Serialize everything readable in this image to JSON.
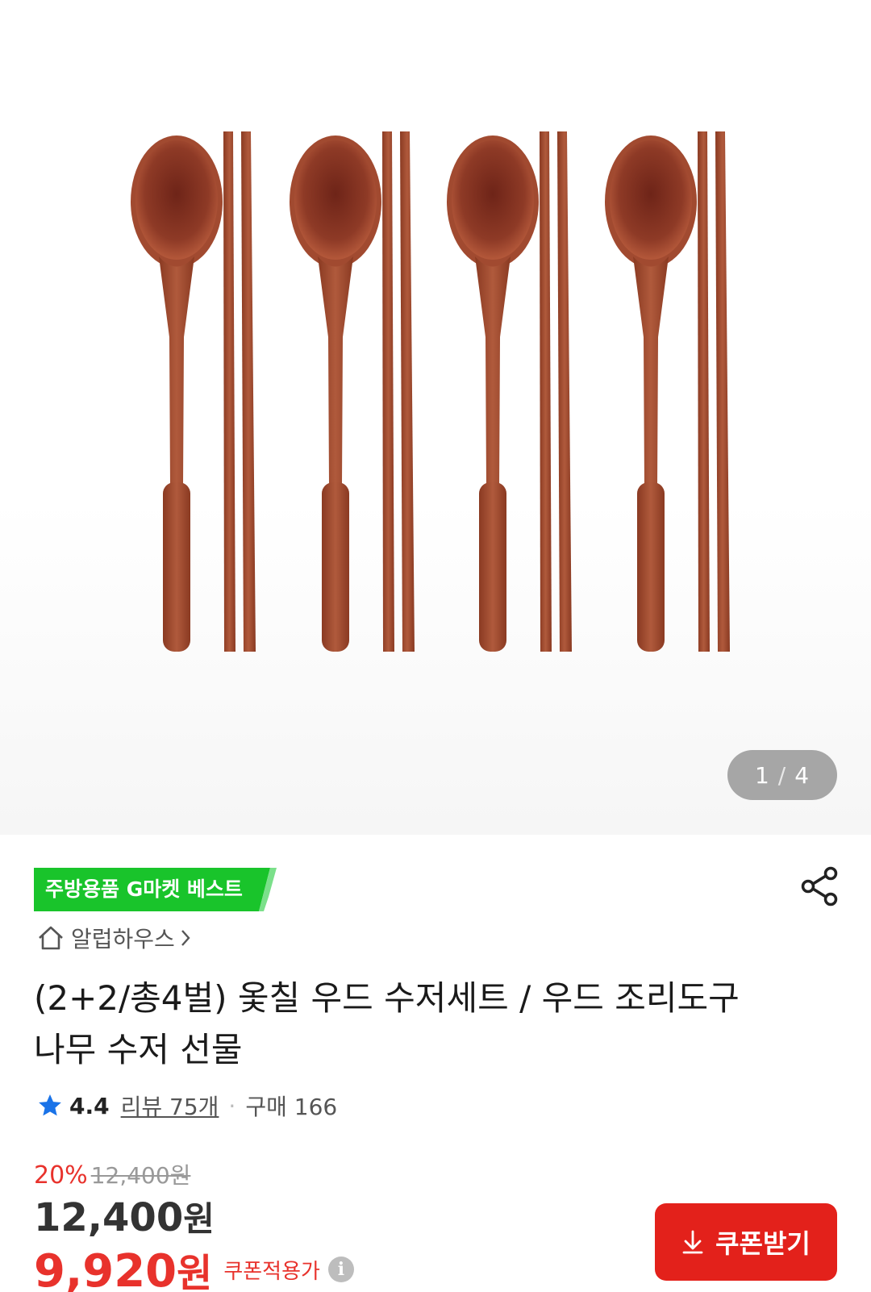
{
  "gallery": {
    "current": "1",
    "separator": "/",
    "total": "4"
  },
  "badge": {
    "label": "주방용품 G마켓 베스트",
    "color": "#19c42b"
  },
  "seller": {
    "name": "알럽하우스"
  },
  "product": {
    "title": "(2+2/총4벌) 옻칠 우드 수저세트 / 우드 조리도구 나무 수저 선물"
  },
  "rating": {
    "score": "4.4",
    "reviews": "리뷰 75개",
    "purchases": "구매 166"
  },
  "price": {
    "discount_rate": "20%",
    "original": "12,400",
    "original_unit": "원",
    "sale": "12,400",
    "sale_unit": "원",
    "coupon_price": "9,920",
    "coupon_unit": "원",
    "coupon_label": "쿠폰적용가",
    "accent_color": "#e8322c"
  },
  "actions": {
    "coupon_button": "쿠폰받기"
  },
  "icons": {
    "share": "share-icon",
    "home": "home-icon",
    "star": "star-icon",
    "info": "info-icon",
    "download": "download-icon"
  }
}
